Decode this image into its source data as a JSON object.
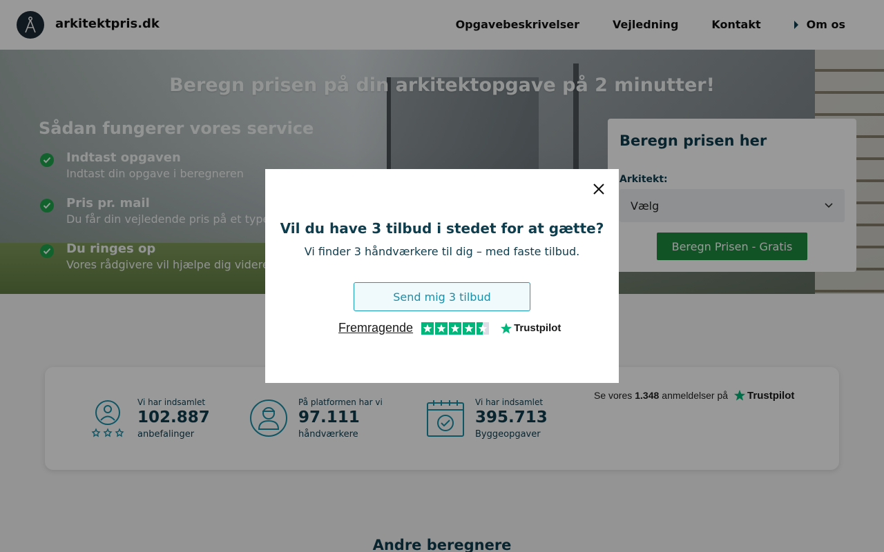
{
  "header": {
    "brand": "arkitektpris.dk",
    "nav": [
      {
        "label": "Opgavebeskrivelser"
      },
      {
        "label": "Vejledning"
      },
      {
        "label": "Kontakt"
      },
      {
        "label": "Om os"
      }
    ]
  },
  "hero": {
    "title": "Beregn prisen på din arkitektopgave på 2 minutter!",
    "how_title": "Sådan fungerer vores service",
    "steps": [
      {
        "title": "Indtast opgaven",
        "text": "Indtast din opgave i beregneren"
      },
      {
        "title": "Pris pr. mail",
        "text": "Du får din vejledende pris på et typehus"
      },
      {
        "title": "Du ringes op",
        "text": "Vores rådgivere vil hjælpe dig videre med"
      }
    ]
  },
  "calculator": {
    "title": "Beregn prisen her",
    "label": "Arkitekt:",
    "select_value": "Vælg",
    "button": "Beregn Prisen - Gratis"
  },
  "stats": {
    "items": [
      {
        "label": "Vi har indsamlet",
        "value": "102.887",
        "sub": "anbefalinger",
        "icon": "person-stars-icon"
      },
      {
        "label": "På platformen har vi",
        "value": "97.111",
        "sub": "håndværkere",
        "icon": "worker-icon"
      },
      {
        "label": "Vi har indsamlet",
        "value": "395.713",
        "sub": "Byggeopgaver",
        "icon": "calendar-check-icon"
      }
    ],
    "review_prefix": "Se vores",
    "review_count": "1.348",
    "review_suffix": "anmeldelser på",
    "trustpilot": "Trustpilot"
  },
  "other": {
    "title": "Andre beregnere"
  },
  "modal": {
    "title": "Vil du have 3 tilbud i stedet for at gætte?",
    "subtitle": "Vi finder 3 håndværkere til dig – med faste tilbud.",
    "button": "Send mig 3 tilbud",
    "rating_word": "Fremragende",
    "trustpilot": "Trustpilot",
    "stars": 4.5
  },
  "colors": {
    "primary": "#0e3d4e",
    "green": "#1e8a3f",
    "trustpilot_green": "#00b67a",
    "accent_teal": "#1a9bb5"
  }
}
